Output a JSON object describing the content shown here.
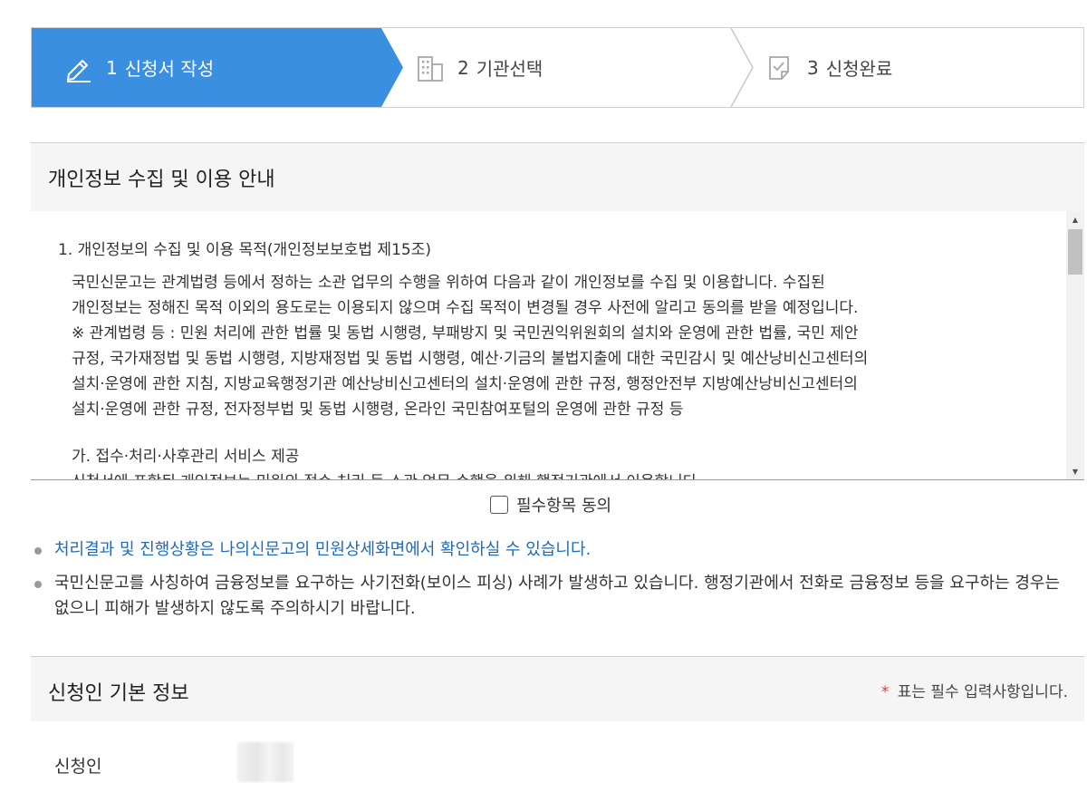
{
  "steps": [
    {
      "num": "1",
      "label": "신청서 작성",
      "icon": "pencil-icon",
      "active": true
    },
    {
      "num": "2",
      "label": "기관선택",
      "icon": "building-icon",
      "active": false
    },
    {
      "num": "3",
      "label": "신청완료",
      "icon": "document-check-icon",
      "active": false
    }
  ],
  "colors": {
    "active_step": "#3a8fe0",
    "link_text": "#1f6bb8",
    "required_star": "#e0393e"
  },
  "privacy": {
    "title": "개인정보 수집 및 이용 안내",
    "item_title": "1. 개인정보의 수집 및 이용 목적(개인정보보호법 제15조)",
    "paragraph_lines": [
      "국민신문고는 관계법령 등에서 정하는 소관 업무의 수행을 위하여 다음과 같이 개인정보를 수집 및 이용합니다. 수집된",
      "개인정보는 정해진 목적 이외의 용도로는 이용되지 않으며 수집 목적이 변경될 경우 사전에 알리고 동의를 받을 예정입니다.",
      "※ 관계법령 등 : 민원 처리에 관한 법률 및 동법 시행령, 부패방지 및 국민권익위원회의 설치와 운영에 관한 법률, 국민 제안",
      "규정, 국가재정법 및 동법 시행령, 지방재정법 및 동법 시행령, 예산·기금의 불법지출에 대한 국민감시 및 예산낭비신고센터의",
      "설치·운영에 관한 지침, 지방교육행정기관 예산낭비신고센터의 설치·운영에 관한 규정, 행정안전부 지방예산낭비신고센터의",
      "설치·운영에 관한 규정, 전자정부법 및 동법 시행령, 온라인 국민참여포털의 운영에 관한 규정 등"
    ],
    "sub_title": "가. 접수·처리·사후관리 서비스 제공",
    "sub_line": "신청서에 포함된 개인정보는 민원의 접수·처리 등 소관 업무 수행을 위해 행정기관에서 이용합니다."
  },
  "agree": {
    "label": "필수항목 동의",
    "checked": false
  },
  "notices": [
    "처리결과 및 진행상황은 나의신문고의 민원상세화면에서 확인하실 수 있습니다.",
    "국민신문고를 사칭하여 금융정보를 요구하는 사기전화(보이스 피싱) 사례가 발생하고 있습니다. 행정기관에서 전화로 금융정보 등을 요구하는 경우는 없으니 피해가 발생하지 않도록 주의하시기 바랍니다."
  ],
  "basic_info": {
    "title": "신청인 기본 정보",
    "required_star": "*",
    "required_note": "표는 필수 입력사항입니다.",
    "applicant_label": "신청인"
  }
}
